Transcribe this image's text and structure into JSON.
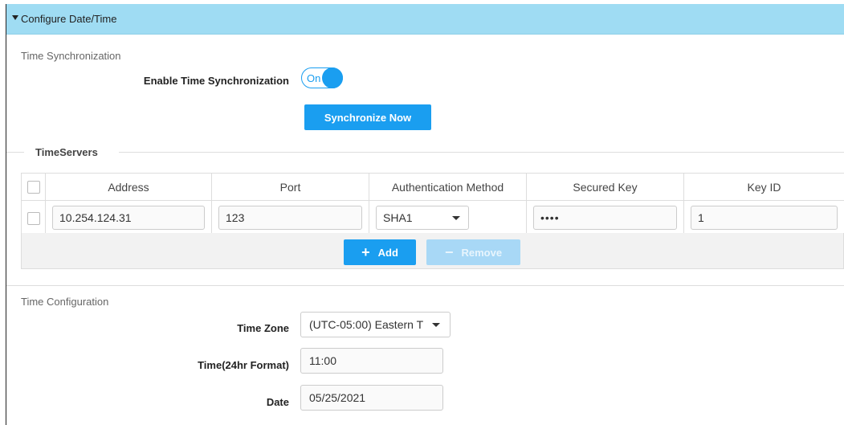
{
  "header": {
    "title": "Configure Date/Time"
  },
  "time_sync": {
    "section_label": "Time Synchronization",
    "enable_label": "Enable Time Synchronization",
    "toggle_label": "On",
    "toggle_state": "on",
    "sync_button": "Synchronize Now"
  },
  "timeservers": {
    "legend": "TimeServers",
    "columns": [
      "Address",
      "Port",
      "Authentication Method",
      "Secured Key",
      "Key ID"
    ],
    "rows": [
      {
        "address": "10.254.124.31",
        "port": "123",
        "auth_method": "SHA1",
        "secured_key": "••••",
        "key_id": "1"
      }
    ],
    "add_button": "Add",
    "remove_button": "Remove"
  },
  "time_config": {
    "section_label": "Time Configuration",
    "timezone_label": "Time Zone",
    "timezone_value": "(UTC-05:00) Eastern T",
    "time_label": "Time(24hr Format)",
    "time_value": "11:00",
    "date_label": "Date",
    "date_value": "05/25/2021"
  },
  "colors": {
    "accent": "#1a9ef0",
    "header_bg": "#9fdcf3"
  },
  "icons": {
    "collapse": "caret-down-icon",
    "add": "plus-icon",
    "remove": "minus-icon",
    "dropdown": "chevron-down-icon"
  }
}
